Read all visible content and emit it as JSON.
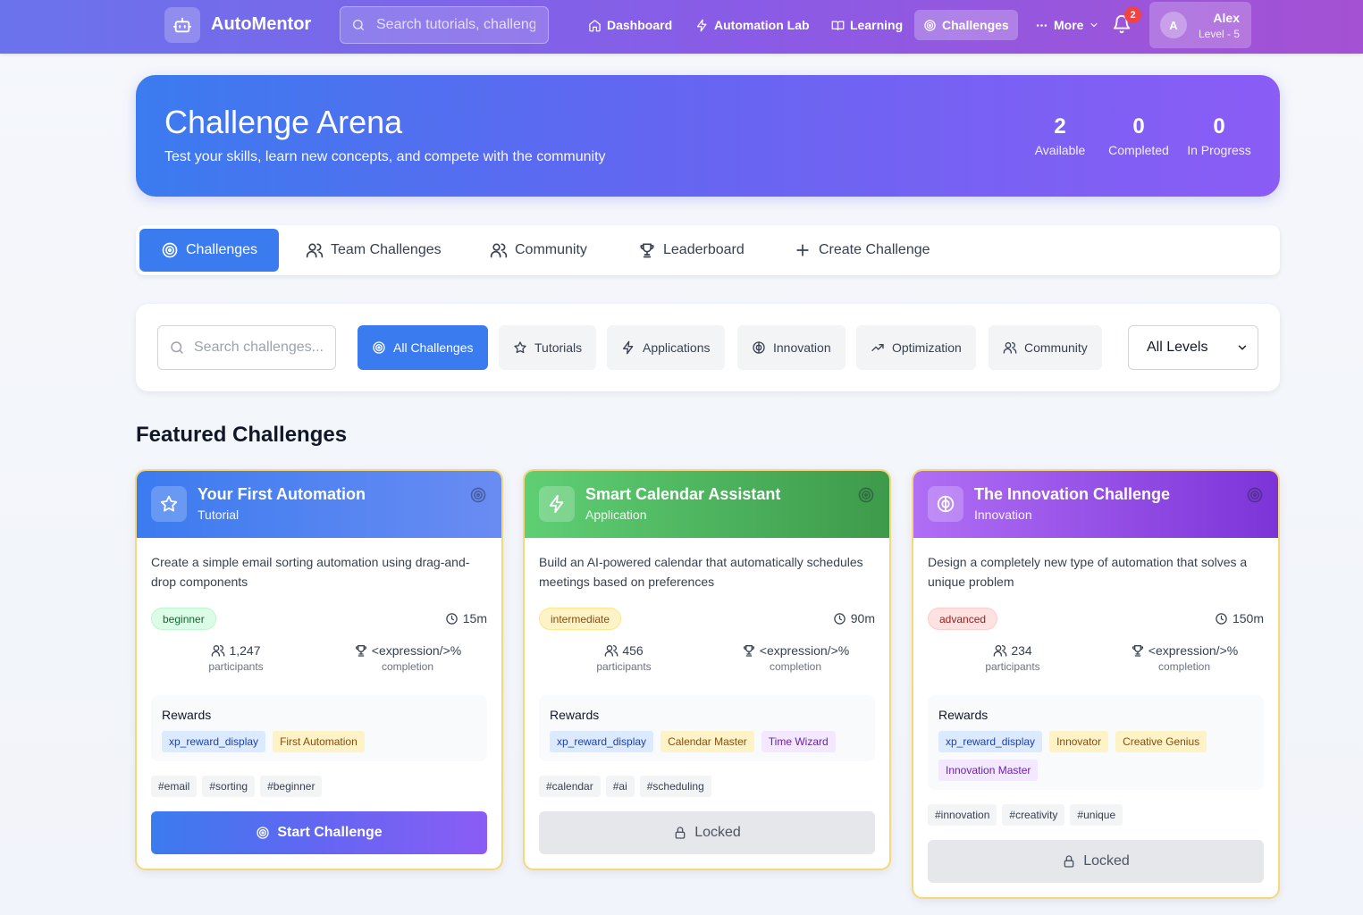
{
  "app": {
    "brand": "AutoMentor",
    "search_placeholder": "Search tutorials, challenges...",
    "nav": [
      {
        "label": "Dashboard",
        "icon": "home-icon"
      },
      {
        "label": "Automation Lab",
        "icon": "bolt-icon"
      },
      {
        "label": "Learning",
        "icon": "book-icon"
      },
      {
        "label": "Challenges",
        "icon": "target-icon",
        "active": true
      },
      {
        "label": "More",
        "icon": "ellipsis-icon"
      }
    ],
    "notifications_count": "2",
    "user": {
      "initial": "A",
      "name": "Alex",
      "level": "Level - 5"
    }
  },
  "hero": {
    "title": "Challenge Arena",
    "subtitle": "Test your skills, learn new concepts, and compete with the community",
    "stats": [
      {
        "value": "2",
        "label": "Available"
      },
      {
        "value": "0",
        "label": "Completed"
      },
      {
        "value": "0",
        "label": "In Progress"
      }
    ]
  },
  "tabs": [
    {
      "label": "Challenges",
      "icon": "target-icon",
      "active": true
    },
    {
      "label": "Team Challenges",
      "icon": "users-icon"
    },
    {
      "label": "Community",
      "icon": "users-icon"
    },
    {
      "label": "Leaderboard",
      "icon": "trophy-icon"
    },
    {
      "label": "Create Challenge",
      "icon": "plus-icon"
    }
  ],
  "filters": {
    "search_placeholder": "Search challenges...",
    "categories": [
      {
        "label": "All Challenges",
        "icon": "target-icon",
        "active": true
      },
      {
        "label": "Tutorials",
        "icon": "star-icon"
      },
      {
        "label": "Applications",
        "icon": "bolt-icon"
      },
      {
        "label": "Innovation",
        "icon": "brain-icon"
      },
      {
        "label": "Optimization",
        "icon": "trending-up-icon"
      },
      {
        "label": "Community",
        "icon": "users-icon"
      }
    ],
    "level_selected": "All Levels"
  },
  "section_title": "Featured Challenges",
  "cards": [
    {
      "title": "Your First Automation",
      "type": "Tutorial",
      "icon": "star-icon",
      "header_colors": [
        "#3b7bf0",
        "#6a8cf2"
      ],
      "description": "Create a simple email sorting automation using drag-and-drop components",
      "difficulty": "beginner",
      "time": "15m",
      "participants": "1,247",
      "participants_label": "participants",
      "completion": "<expression/>%",
      "completion_label": "completion",
      "rewards_title": "Rewards",
      "rewards": [
        {
          "label": "xp_reward_display",
          "kind": "xp"
        },
        {
          "label": "First Automation",
          "kind": "badge"
        }
      ],
      "tags": [
        "#email",
        "#sorting",
        "#beginner"
      ],
      "cta": "Start Challenge",
      "locked": false
    },
    {
      "title": "Smart Calendar Assistant",
      "type": "Application",
      "icon": "bolt-icon",
      "header_colors": [
        "#5fcf74",
        "#3d9a4a"
      ],
      "description": "Build an AI-powered calendar that automatically schedules meetings based on preferences",
      "difficulty": "intermediate",
      "time": "90m",
      "participants": "456",
      "participants_label": "participants",
      "completion": "<expression/>%",
      "completion_label": "completion",
      "rewards_title": "Rewards",
      "rewards": [
        {
          "label": "xp_reward_display",
          "kind": "xp"
        },
        {
          "label": "Calendar Master",
          "kind": "badge"
        },
        {
          "label": "Time Wizard",
          "kind": "title"
        }
      ],
      "tags": [
        "#calendar",
        "#ai",
        "#scheduling"
      ],
      "cta": "Locked",
      "locked": true
    },
    {
      "title": "The Innovation Challenge",
      "type": "Innovation",
      "icon": "brain-icon",
      "header_colors": [
        "#b06ef5",
        "#7c34d8"
      ],
      "description": "Design a completely new type of automation that solves a unique problem",
      "difficulty": "advanced",
      "time": "150m",
      "participants": "234",
      "participants_label": "participants",
      "completion": "<expression/>%",
      "completion_label": "completion",
      "rewards_title": "Rewards",
      "rewards": [
        {
          "label": "xp_reward_display",
          "kind": "xp"
        },
        {
          "label": "Innovator",
          "kind": "badge"
        },
        {
          "label": "Creative Genius",
          "kind": "badge"
        },
        {
          "label": "Innovation Master",
          "kind": "title"
        }
      ],
      "tags": [
        "#innovation",
        "#creativity",
        "#unique"
      ],
      "cta": "Locked",
      "locked": true
    }
  ]
}
